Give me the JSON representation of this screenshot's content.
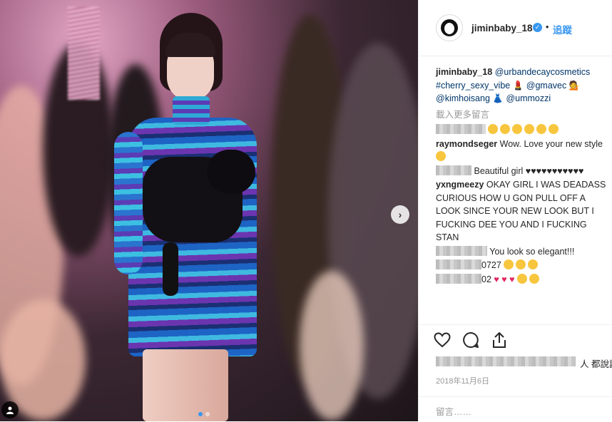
{
  "header": {
    "username": "jiminbaby_18",
    "follow_label": "追蹤",
    "dot": "•"
  },
  "caption": {
    "username": "jiminbaby_18",
    "mention1": "@urbandecaycosmetics",
    "hashtag": "#cherry_sexy_vibe",
    "mention2": "@gmavec",
    "mention3": "@kimhoisang",
    "mention4": "@ummozzi"
  },
  "load_more": "載入更多留言",
  "comments": [
    {
      "username": "raymondseger",
      "text": "Wow. Love your new style"
    },
    {
      "text": "Beautiful girl"
    },
    {
      "username": "yxngmeezy",
      "text": "OKAY GIRL I WAS DEADASS CURIOUS HOW U GON PULL OFF A LOOK SINCE YOUR NEW LOOK BUT I FUCKING DEE YOU AND I FUCKING STAN"
    },
    {
      "text": "You look so elegant!!!"
    },
    {
      "text": "0727"
    },
    {
      "text": "02"
    }
  ],
  "likes_suffix": "人 都說讚",
  "date": "2018年11月6日",
  "add_comment_placeholder": "留言……",
  "nav": {
    "next": "›"
  },
  "colors": {
    "link": "#003569",
    "accent": "#3897f0",
    "muted": "#999999"
  },
  "icons": [
    "heart-icon",
    "comment-icon",
    "share-icon",
    "verified-badge-icon",
    "user-tag-icon",
    "chevron-right-icon"
  ]
}
